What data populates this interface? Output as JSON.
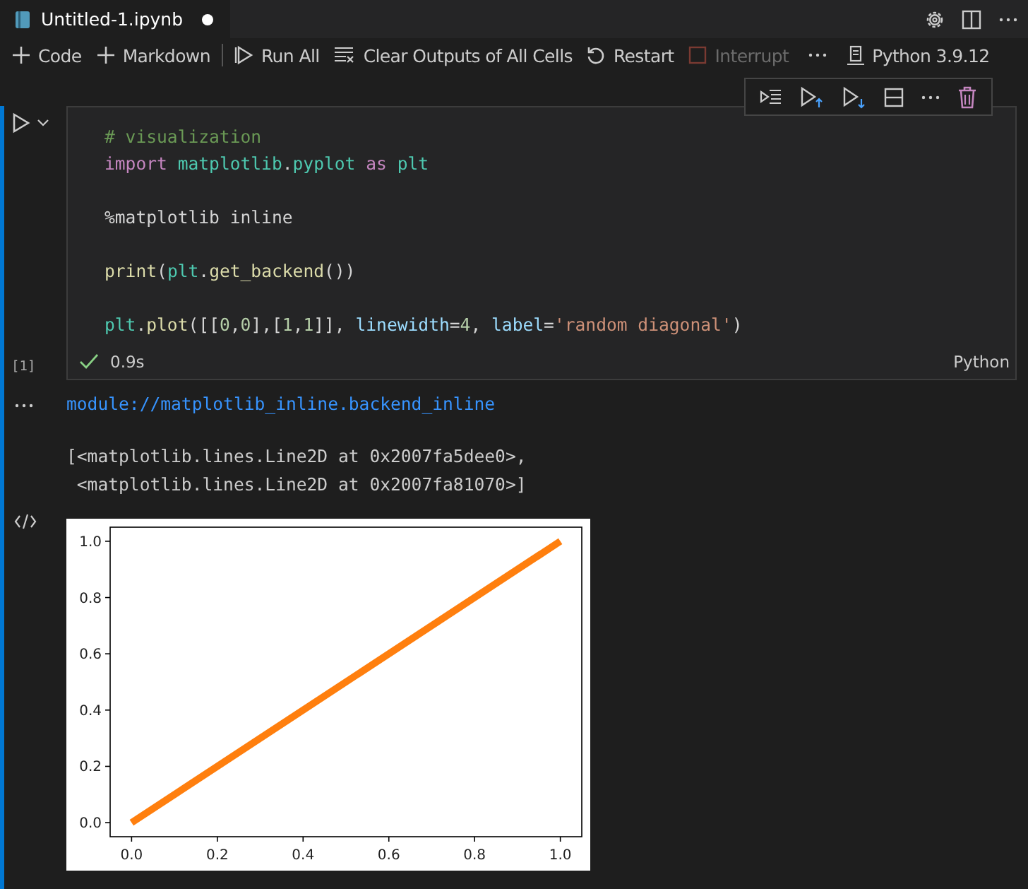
{
  "tab": {
    "title": "Untitled-1.ipynb",
    "unsaved": true
  },
  "toolbar": [
    {
      "kind": "add",
      "label": "Code",
      "disabled": false
    },
    {
      "kind": "add",
      "label": "Markdown",
      "disabled": false
    },
    {
      "kind": "runall",
      "label": "Run All",
      "disabled": false
    },
    {
      "kind": "clear",
      "label": "Clear Outputs of All Cells",
      "disabled": false
    },
    {
      "kind": "restart",
      "label": "Restart",
      "disabled": false
    },
    {
      "kind": "interrupt",
      "label": "Interrupt",
      "disabled": true
    }
  ],
  "kernel": "Python 3.9.12",
  "cell": {
    "execution_count": "[1]",
    "succeeded": true,
    "duration": "0.9s",
    "language": "Python",
    "code_lines": [
      {
        "kind": "code",
        "tokens": [
          {
            "kind": "comment",
            "text": "# visualization"
          }
        ]
      },
      {
        "kind": "code",
        "tokens": [
          {
            "kind": "keyword",
            "text": "import "
          },
          {
            "kind": "module",
            "text": "matplotlib"
          },
          {
            "kind": "plain",
            "text": "."
          },
          {
            "kind": "module",
            "text": "pyplot "
          },
          {
            "kind": "keyword",
            "text": "as "
          },
          {
            "kind": "module",
            "text": "plt"
          }
        ]
      },
      {
        "kind": "blank"
      },
      {
        "kind": "code",
        "tokens": [
          {
            "kind": "plain",
            "text": "%matplotlib inline"
          }
        ]
      },
      {
        "kind": "blank"
      },
      {
        "kind": "code",
        "tokens": [
          {
            "kind": "func",
            "text": "print"
          },
          {
            "kind": "plain",
            "text": "("
          },
          {
            "kind": "module",
            "text": "plt"
          },
          {
            "kind": "plain",
            "text": "."
          },
          {
            "kind": "func",
            "text": "get_backend"
          },
          {
            "kind": "plain",
            "text": "())"
          }
        ]
      },
      {
        "kind": "blank"
      },
      {
        "kind": "code",
        "tokens": [
          {
            "kind": "module",
            "text": "plt"
          },
          {
            "kind": "plain",
            "text": "."
          },
          {
            "kind": "func",
            "text": "plot"
          },
          {
            "kind": "plain",
            "text": "([["
          },
          {
            "kind": "number",
            "text": "0"
          },
          {
            "kind": "plain",
            "text": ","
          },
          {
            "kind": "number",
            "text": "0"
          },
          {
            "kind": "plain",
            "text": "],["
          },
          {
            "kind": "number",
            "text": "1"
          },
          {
            "kind": "plain",
            "text": ","
          },
          {
            "kind": "number",
            "text": "1"
          },
          {
            "kind": "plain",
            "text": "]], "
          },
          {
            "kind": "param",
            "text": "linewidth"
          },
          {
            "kind": "plain",
            "text": "="
          },
          {
            "kind": "number",
            "text": "4"
          },
          {
            "kind": "plain",
            "text": ", "
          },
          {
            "kind": "param",
            "text": "label"
          },
          {
            "kind": "plain",
            "text": "="
          },
          {
            "kind": "string",
            "text": "'random diagonal'"
          },
          {
            "kind": "plain",
            "text": ")"
          }
        ]
      }
    ],
    "outputs": [
      {
        "kind": "stream",
        "text": "module://matplotlib_inline.backend_inline"
      },
      {
        "kind": "text",
        "lines": [
          "[<matplotlib.lines.Line2D at 0x2007fa5dee0>,",
          " <matplotlib.lines.Line2D at 0x2007fa81070>]"
        ]
      },
      {
        "kind": "image",
        "chart_data": {
          "type": "line",
          "x": [
            0,
            1
          ],
          "series": [
            {
              "color": "#ff7f0e",
              "values": [
                0,
                1
              ]
            }
          ],
          "xlim": [
            -0.05,
            1.05
          ],
          "ylim": [
            -0.05,
            1.05
          ],
          "xticks": [
            {
              "value": 0,
              "label": "0.0"
            },
            {
              "value": 0.2,
              "label": "0.2"
            },
            {
              "value": 0.4,
              "label": "0.4"
            },
            {
              "value": 0.6,
              "label": "0.6"
            },
            {
              "value": 0.8,
              "label": "0.8"
            },
            {
              "value": 1,
              "label": "1.0"
            }
          ],
          "yticks": [
            {
              "value": 0,
              "label": "0.0"
            },
            {
              "value": 0.2,
              "label": "0.2"
            },
            {
              "value": 0.4,
              "label": "0.4"
            },
            {
              "value": 0.6,
              "label": "0.6"
            },
            {
              "value": 0.8,
              "label": "0.8"
            },
            {
              "value": 1,
              "label": "1.0"
            }
          ]
        }
      }
    ]
  }
}
